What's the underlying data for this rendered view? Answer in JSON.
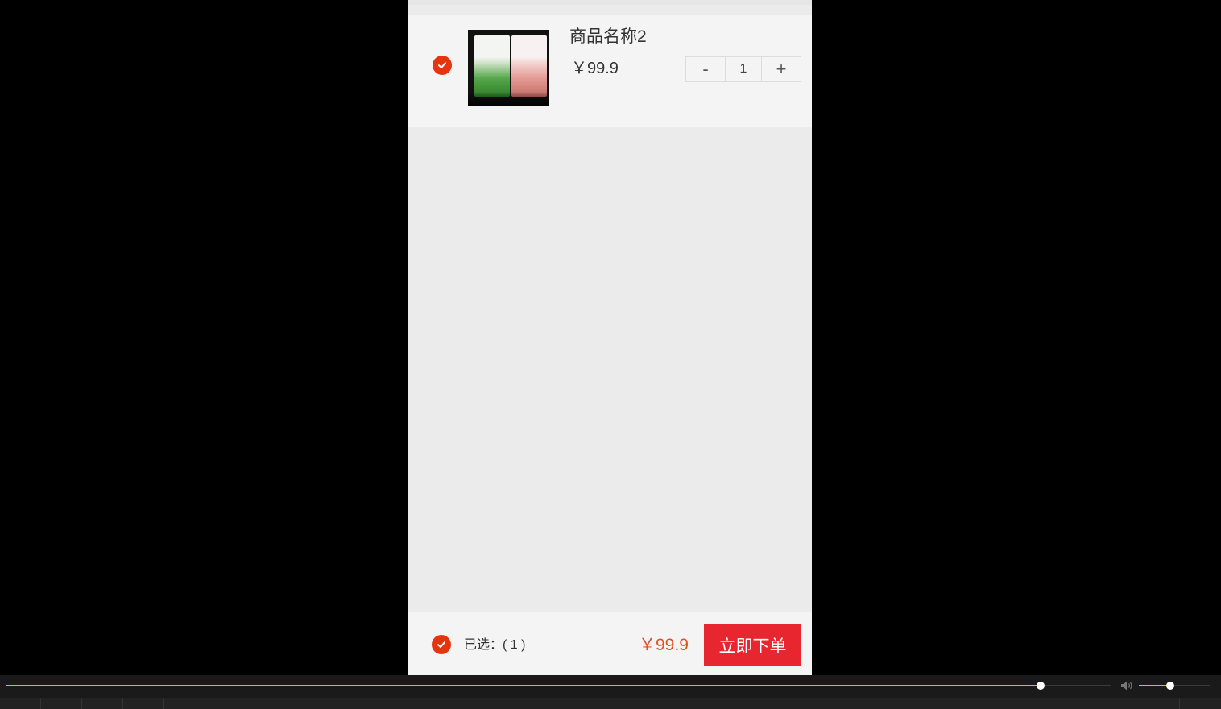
{
  "cart": {
    "items": [
      {
        "name": "商品名称2",
        "price": "￥99.9",
        "quantity": "1",
        "selected": true,
        "decrement_label": "-",
        "increment_label": "+"
      }
    ]
  },
  "footer": {
    "selected_label": "已选：( 1 )",
    "total": "￥99.9",
    "order_button_label": "立即下单"
  },
  "player": {
    "progress": 0.936,
    "volume": 0.44
  },
  "colors": {
    "accent_red": "#e5350f",
    "order_button": "#e8262f",
    "price_orange": "#e0501e",
    "progress_yellow": "#e8b80c"
  },
  "icons": {
    "check": "check-circle-icon",
    "volume": "speaker-icon"
  }
}
